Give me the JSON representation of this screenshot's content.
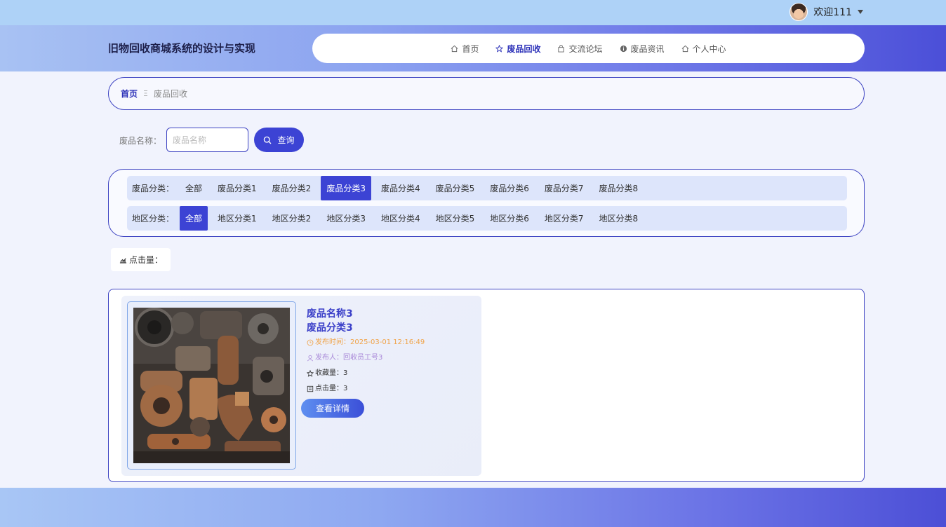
{
  "user": {
    "greeting": "欢迎111"
  },
  "header": {
    "site_title": "旧物回收商城系统的设计与实现",
    "nav": [
      {
        "label": "首页",
        "icon": "home-icon"
      },
      {
        "label": "废品回收",
        "icon": "star-icon",
        "active": true
      },
      {
        "label": "交流论坛",
        "icon": "bag-icon"
      },
      {
        "label": "废品资讯",
        "icon": "info-icon"
      },
      {
        "label": "个人中心",
        "icon": "home-icon"
      }
    ]
  },
  "breadcrumb": {
    "home": "首页",
    "separator": "Ξ",
    "current": "废品回收"
  },
  "search": {
    "label": "废品名称：",
    "placeholder": "废品名称",
    "value": "",
    "button": "查询"
  },
  "filters": {
    "category": {
      "label": "废品分类：",
      "options": [
        "全部",
        "废品分类1",
        "废品分类2",
        "废品分类3",
        "废品分类4",
        "废品分类5",
        "废品分类6",
        "废品分类7",
        "废品分类8"
      ],
      "selected": "废品分类3"
    },
    "region": {
      "label": "地区分类：",
      "options": [
        "全部",
        "地区分类1",
        "地区分类2",
        "地区分类3",
        "地区分类4",
        "地区分类5",
        "地区分类6",
        "地区分类7",
        "地区分类8"
      ],
      "selected": "全部"
    }
  },
  "sort": {
    "label": "点击量："
  },
  "items": [
    {
      "name": "废品名称3",
      "category": "废品分类3",
      "time": "发布时间：2025-03-01 12:16:49",
      "publisher": "发布人：回收员工号3",
      "favorites": "收藏量：3",
      "clicks": "点击量：3",
      "button": "查看详情"
    }
  ],
  "colors": {
    "primary": "#3c43d4",
    "accent_border": "#3e44c2",
    "time": "#f0a44a",
    "publisher": "#a988d8"
  }
}
